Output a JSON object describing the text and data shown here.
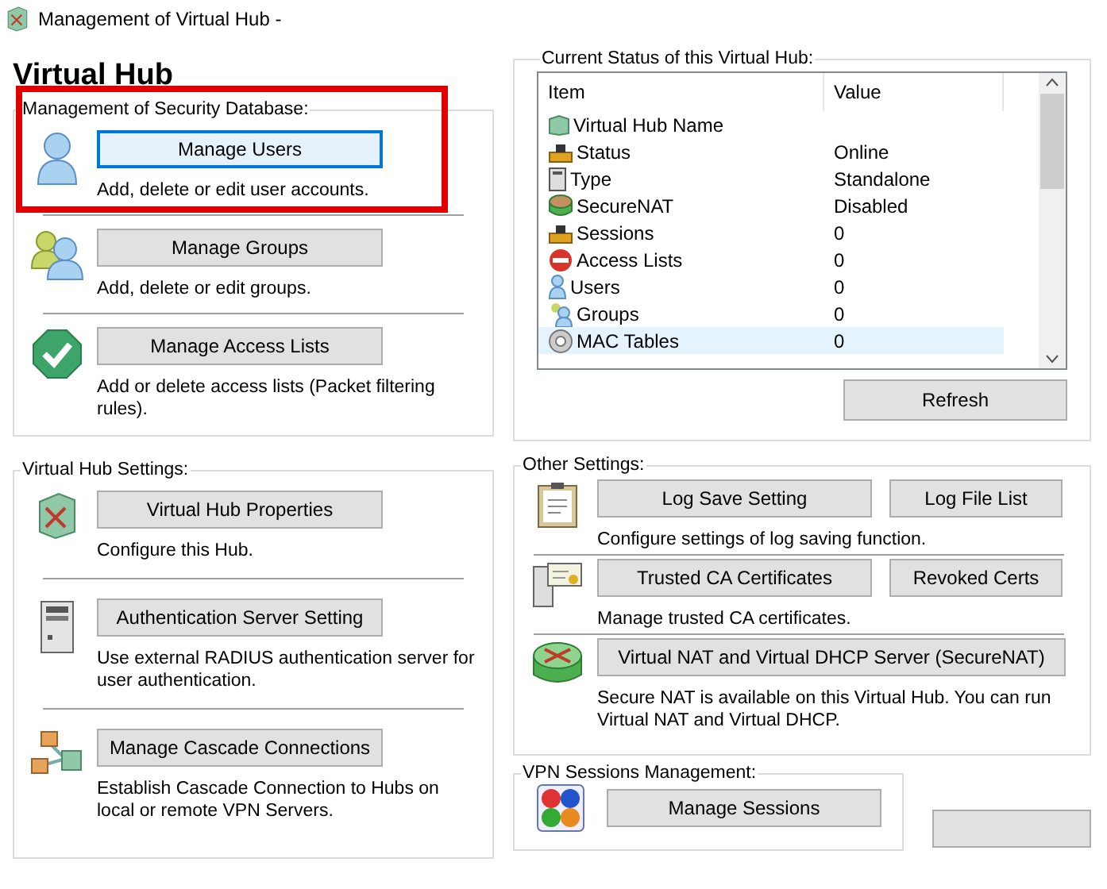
{
  "window": {
    "title": "Management of Virtual Hub -"
  },
  "heading": "Virtual Hub",
  "left_sections": [
    {
      "title": "Management of Security Database:",
      "items": [
        {
          "buttons": [
            {
              "label": "Manage Users",
              "focused": true
            }
          ],
          "description": "Add, delete or edit user accounts.",
          "highlighted": true
        },
        {
          "buttons": [
            {
              "label": "Manage Groups",
              "focused": false
            }
          ],
          "description": "Add, delete or edit groups.",
          "highlighted": false
        },
        {
          "buttons": [
            {
              "label": "Manage Access Lists",
              "focused": false
            }
          ],
          "description": "Add or delete access lists (Packet filtering rules).",
          "highlighted": false
        }
      ]
    },
    {
      "title": "Virtual Hub Settings:",
      "items": [
        {
          "buttons": [
            {
              "label": "Virtual Hub Properties",
              "focused": false
            }
          ],
          "description": "Configure this Hub.",
          "highlighted": false
        },
        {
          "buttons": [
            {
              "label": "Authentication Server Setting",
              "focused": false
            }
          ],
          "description": "Use external RADIUS authentication server for user authentication.",
          "highlighted": false
        },
        {
          "buttons": [
            {
              "label": "Manage Cascade Connections",
              "focused": false
            }
          ],
          "description": "Establish Cascade Connection to Hubs on local or remote VPN Servers.",
          "highlighted": false
        }
      ]
    }
  ],
  "status": {
    "title": "Current Status of this Virtual Hub:",
    "columns": [
      "Item",
      "Value"
    ],
    "rows": [
      {
        "item": "Virtual Hub Name",
        "value": "",
        "selected": false
      },
      {
        "item": "Status",
        "value": "Online",
        "selected": false
      },
      {
        "item": "Type",
        "value": "Standalone",
        "selected": false
      },
      {
        "item": "SecureNAT",
        "value": "Disabled",
        "selected": false
      },
      {
        "item": "Sessions",
        "value": "0",
        "selected": false
      },
      {
        "item": "Access Lists",
        "value": "0",
        "selected": false
      },
      {
        "item": "Users",
        "value": "0",
        "selected": false
      },
      {
        "item": "Groups",
        "value": "0",
        "selected": false
      },
      {
        "item": "MAC Tables",
        "value": "0",
        "selected": true
      }
    ],
    "refresh": "Refresh"
  },
  "other_settings": {
    "title": "Other Settings:",
    "items": [
      {
        "buttons": [
          {
            "label": "Log Save Setting",
            "focused": false
          },
          {
            "label": "Log File List",
            "focused": false
          }
        ],
        "description": "Configure settings of log saving function.",
        "highlighted": false
      },
      {
        "buttons": [
          {
            "label": "Trusted CA Certificates",
            "focused": false
          },
          {
            "label": "Revoked Certs",
            "focused": false
          }
        ],
        "description": "Manage trusted CA certificates.",
        "highlighted": false
      },
      {
        "buttons": [
          {
            "label": "Virtual NAT and Virtual DHCP Server (SecureNAT)",
            "focused": false
          }
        ],
        "description": "Secure NAT is available on this Virtual Hub. You can run Virtual NAT and Virtual DHCP.",
        "highlighted": false
      }
    ]
  },
  "vpn_sessions": {
    "title": "VPN Sessions Management:",
    "button": "Manage Sessions"
  }
}
